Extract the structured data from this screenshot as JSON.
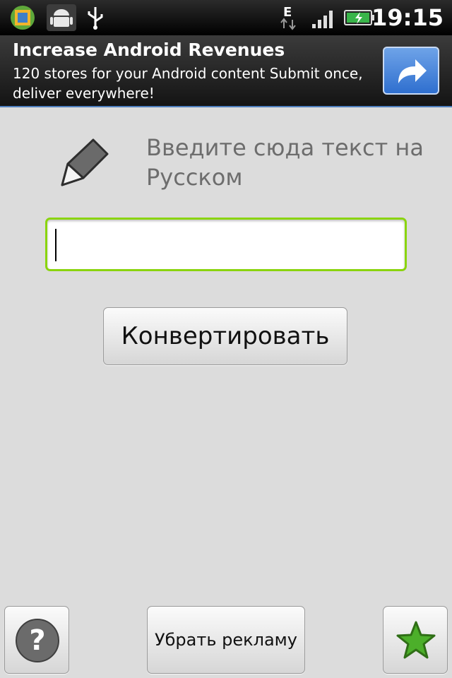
{
  "status_bar": {
    "time": "19:15",
    "network_type": "E",
    "icons": [
      "app-icon",
      "android-icon",
      "usb-icon",
      "network-e-icon",
      "signal-icon",
      "battery-charging-icon"
    ]
  },
  "ad": {
    "title": "Increase Android Revenues",
    "text": "120 stores for your Android content Submit once, deliver everywhere!",
    "button_icon": "share-arrow-icon",
    "button_color": "#3a7bd5"
  },
  "main": {
    "prompt": "Введите сюда текст на Русском",
    "input_value": "",
    "input_border_color": "#8ad40e",
    "convert_label": "Конвертировать"
  },
  "bottom_bar": {
    "help_icon": "question-icon",
    "remove_ads_label": "Убрать рекламу",
    "favorite_icon": "star-icon",
    "star_color": "#4caf2a"
  }
}
